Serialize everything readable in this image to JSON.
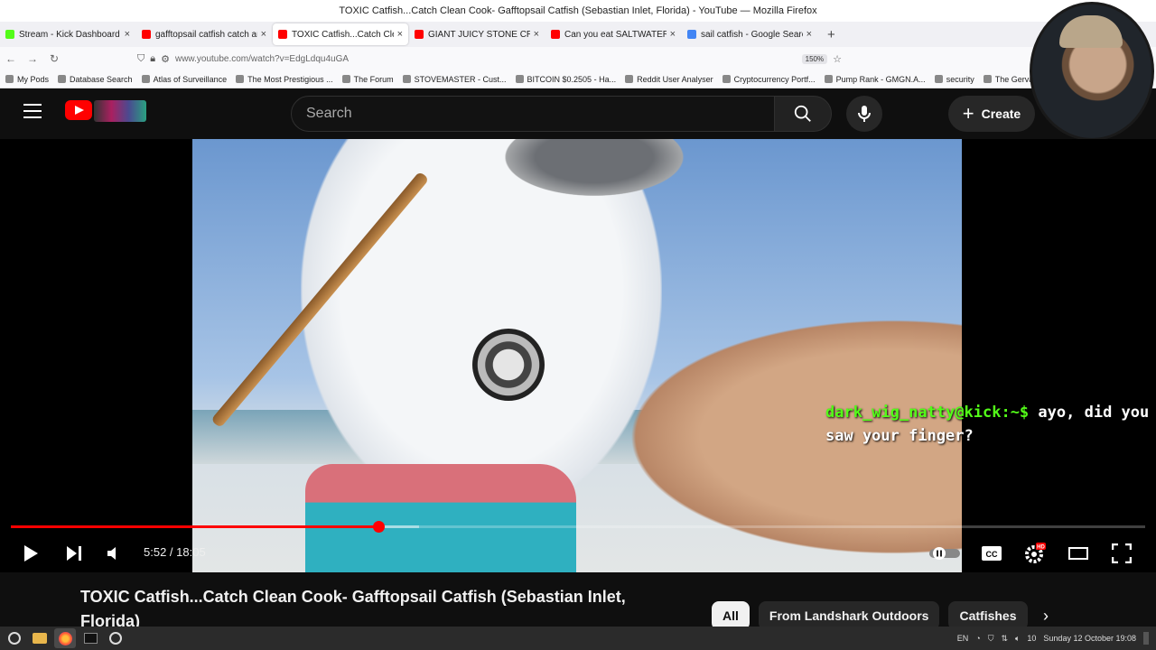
{
  "window": {
    "title": "TOXIC Catfish...Catch Clean Cook- Gafftopsail Catfish (Sebastian Inlet, Florida) - YouTube — Mozilla Firefox"
  },
  "tabs": [
    {
      "label": "Stream - Kick Dashboard",
      "favicon_color": "#53fc18",
      "active": false
    },
    {
      "label": "gafftopsail catfish catch and",
      "favicon_color": "#ff0000",
      "active": false
    },
    {
      "label": "TOXIC Catfish...Catch Clean",
      "favicon_color": "#ff0000",
      "active": true
    },
    {
      "label": "GIANT JUICY STONE CRAB |",
      "favicon_color": "#ff0000",
      "active": false
    },
    {
      "label": "Can you eat SALTWATER CA",
      "favicon_color": "#ff0000",
      "active": false
    },
    {
      "label": "sail catfish - Google Search",
      "favicon_color": "#4285f4",
      "active": false
    }
  ],
  "nav": {
    "url": "www.youtube.com/watch?v=EdgLdqu4uGA",
    "zoom": "150%"
  },
  "bookmarks": [
    "My Pods",
    "Database Search",
    "Atlas of Surveillance",
    "The Most Prestigious ...",
    "The Forum",
    "STOVEMASTER - Cust...",
    "BITCOIN $0.2505 - Ha...",
    "Reddit User Analyser",
    "Cryptocurrency Portf...",
    "Pump Rank - GMGN.A...",
    "security",
    "The Gervais Pri"
  ],
  "youtube": {
    "search_placeholder": "Search",
    "create_label": "Create",
    "brand_color": "#ff0000"
  },
  "overlay_chat": {
    "user": "dark_wig_natty@kick:~$",
    "message": "ayo, did you saw your finger?",
    "user_color": "#53fc18"
  },
  "player": {
    "current_time": "5:52",
    "duration": "18:05",
    "time_display": "5:52 / 18:05",
    "played_fraction": 0.324,
    "buffered_fraction": 0.36
  },
  "video": {
    "title": "TOXIC Catfish...Catch Clean Cook- Gafftopsail Catfish (Sebastian Inlet, Florida)"
  },
  "chips": [
    "All",
    "From Landshark Outdoors",
    "Catfishes"
  ],
  "taskbar": {
    "lang": "EN",
    "volume": "10",
    "clock": "Sunday 12 October 19:08"
  }
}
